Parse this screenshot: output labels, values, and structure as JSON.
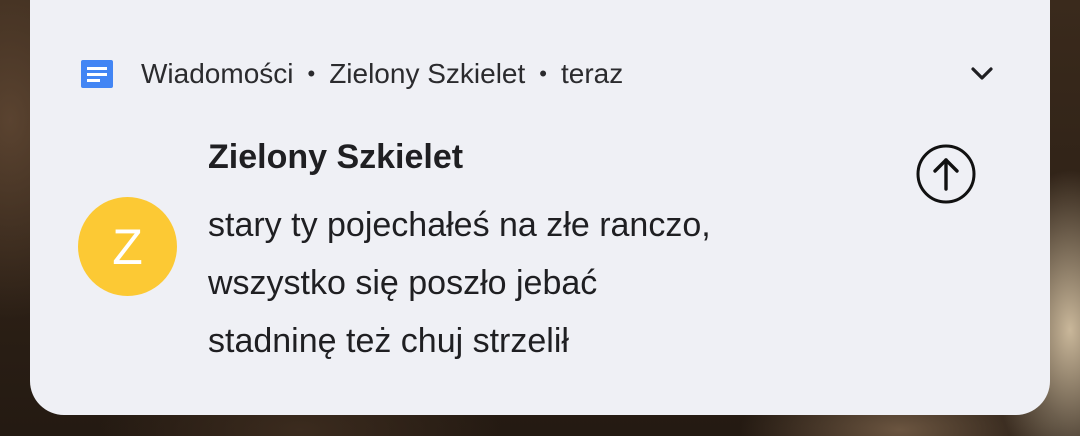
{
  "notification": {
    "app_name": "Wiadomości",
    "sender_header": "Zielony Szkielet",
    "time": "teraz",
    "separator": "•",
    "sender": "Zielony Szkielet",
    "avatar_letter": "Z",
    "avatar_color": "#fcc934",
    "app_icon_color": "#4285f4",
    "message_lines": [
      "stary ty pojechałeś na złe ranczo,",
      "wszystko się poszło jebać",
      "stadninę też chuj strzelił"
    ]
  }
}
